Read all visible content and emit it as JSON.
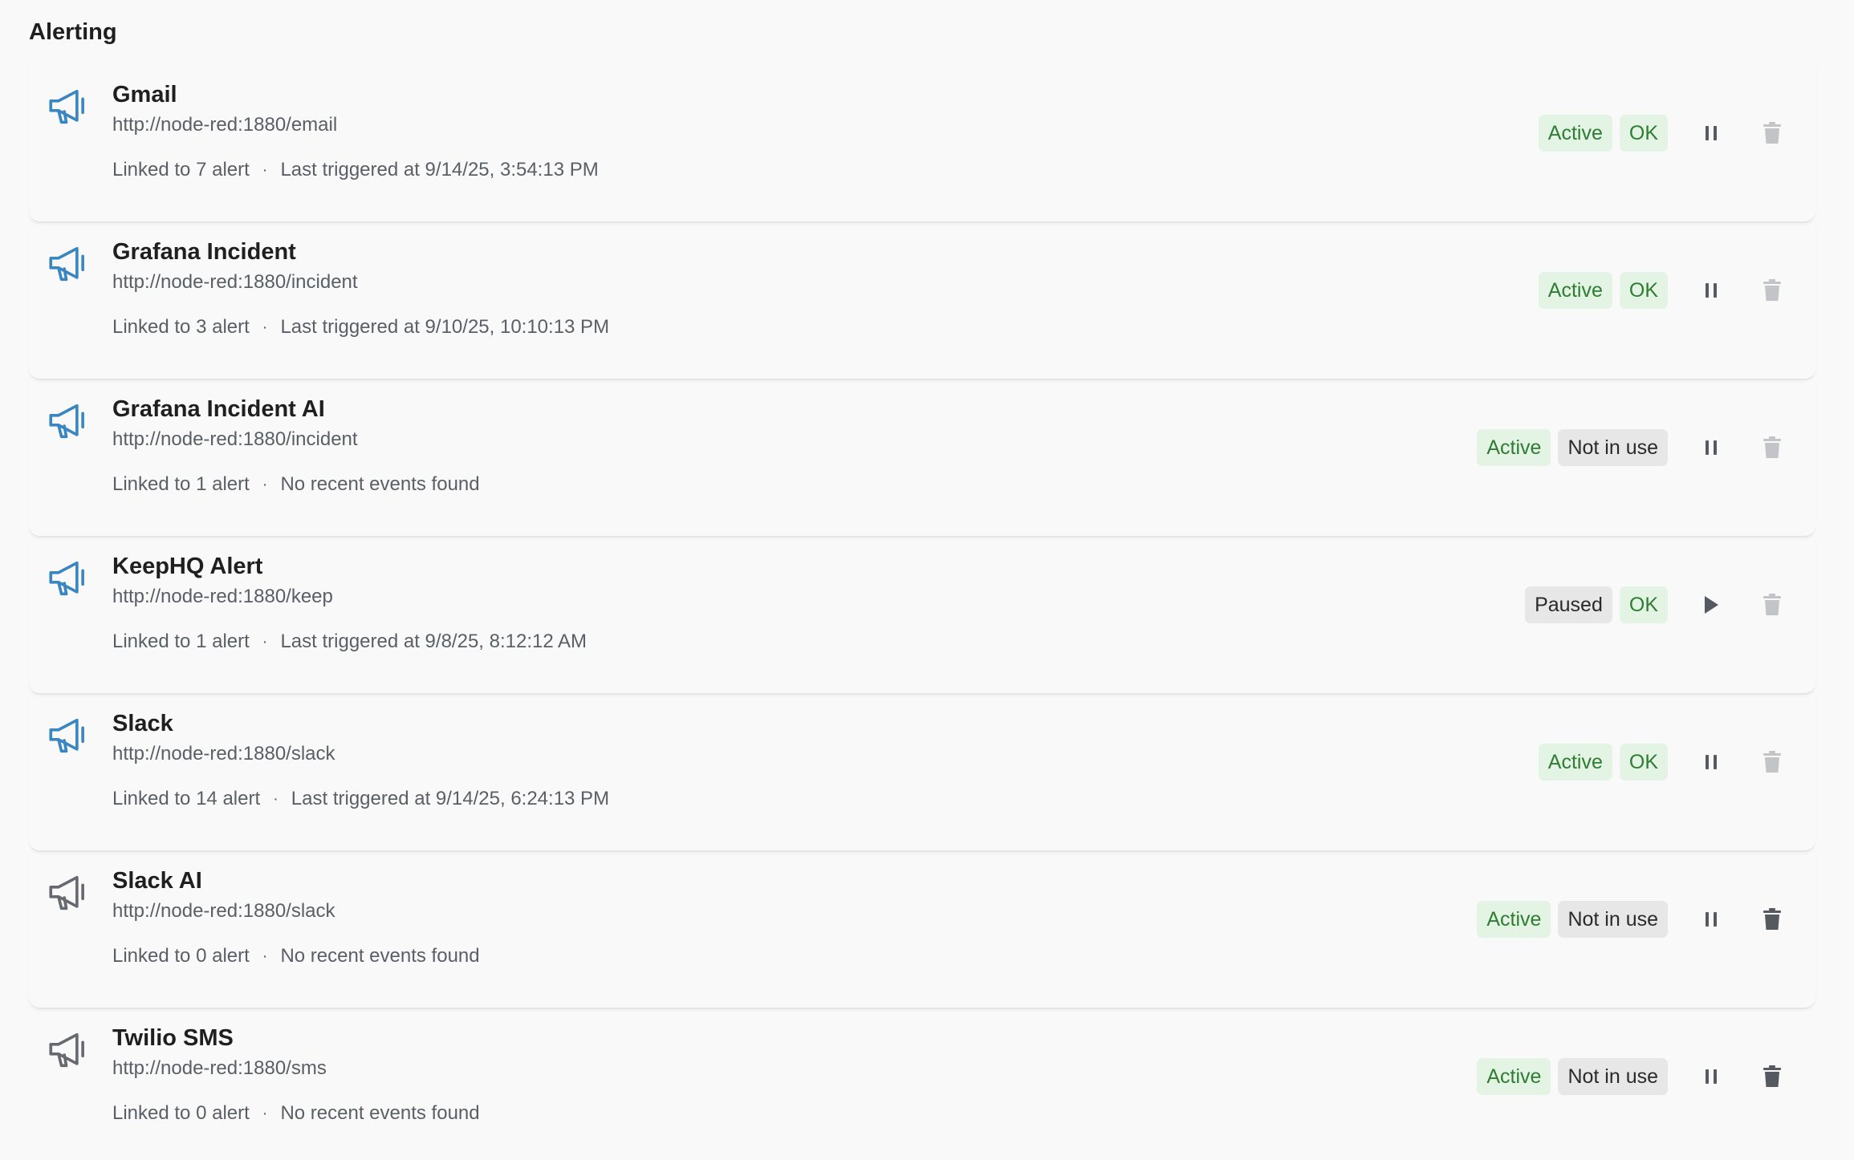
{
  "section": {
    "title": "Alerting"
  },
  "colors": {
    "active_icon": "#3a86c0",
    "inactive_icon": "#666a70",
    "badge_green_bg": "#e3f3e4",
    "badge_green_text": "#2e7d32",
    "badge_gray_bg": "#e7e7e7",
    "badge_gray_text": "#2a2a2a"
  },
  "rows": [
    {
      "name": "Gmail",
      "url": "http://node-red:1880/email",
      "linked": "Linked to 7 alert",
      "separator": "·",
      "last_event": "Last triggered at 9/14/25, 3:54:13 PM",
      "state_badge": "Active",
      "health_badge": "OK",
      "toggle_icon": "pause-icon",
      "icon": "megaphone-icon",
      "delete_icon": "trash-icon",
      "delete_enabled": false
    },
    {
      "name": "Grafana Incident",
      "url": "http://node-red:1880/incident",
      "linked": "Linked to 3 alert",
      "separator": "·",
      "last_event": "Last triggered at 9/10/25, 10:10:13 PM",
      "state_badge": "Active",
      "health_badge": "OK",
      "toggle_icon": "pause-icon",
      "icon": "megaphone-icon",
      "delete_icon": "trash-icon",
      "delete_enabled": false
    },
    {
      "name": "Grafana Incident AI",
      "url": "http://node-red:1880/incident",
      "linked": "Linked to 1 alert",
      "separator": "·",
      "last_event": "No recent events found",
      "state_badge": "Active",
      "health_badge": "Not in use",
      "toggle_icon": "pause-icon",
      "icon": "megaphone-icon",
      "delete_icon": "trash-icon",
      "delete_enabled": false
    },
    {
      "name": "KeepHQ Alert",
      "url": "http://node-red:1880/keep",
      "linked": "Linked to 1 alert",
      "separator": "·",
      "last_event": "Last triggered at 9/8/25, 8:12:12 AM",
      "state_badge": "Paused",
      "health_badge": "OK",
      "toggle_icon": "play-icon",
      "icon": "megaphone-icon",
      "delete_icon": "trash-icon",
      "delete_enabled": false
    },
    {
      "name": "Slack",
      "url": "http://node-red:1880/slack",
      "linked": "Linked to 14 alert",
      "separator": "·",
      "last_event": "Last triggered at 9/14/25, 6:24:13 PM",
      "state_badge": "Active",
      "health_badge": "OK",
      "toggle_icon": "pause-icon",
      "icon": "megaphone-icon",
      "delete_icon": "trash-icon",
      "delete_enabled": false
    },
    {
      "name": "Slack AI",
      "url": "http://node-red:1880/slack",
      "linked": "Linked to 0 alert",
      "separator": "·",
      "last_event": "No recent events found",
      "state_badge": "Active",
      "health_badge": "Not in use",
      "toggle_icon": "pause-icon",
      "icon": "megaphone-icon",
      "delete_icon": "trash-icon",
      "delete_enabled": true
    },
    {
      "name": "Twilio SMS",
      "url": "http://node-red:1880/sms",
      "linked": "Linked to 0 alert",
      "separator": "·",
      "last_event": "No recent events found",
      "state_badge": "Active",
      "health_badge": "Not in use",
      "toggle_icon": "pause-icon",
      "icon": "megaphone-icon",
      "delete_icon": "trash-icon",
      "delete_enabled": true
    }
  ]
}
